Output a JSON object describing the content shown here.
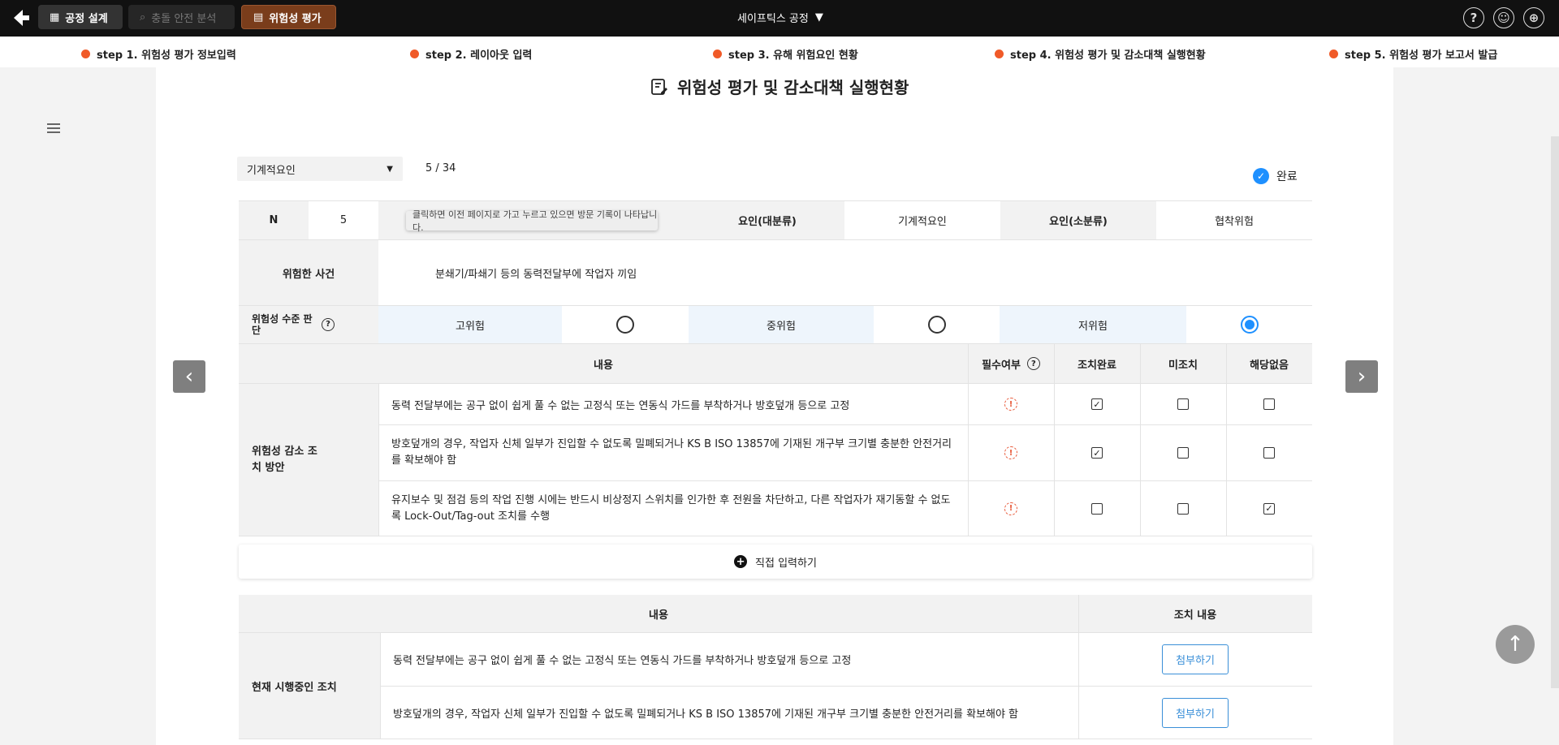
{
  "topbar": {
    "buttons": [
      "공정 설계",
      "충돌 안전 분석",
      "위험성 평가"
    ],
    "factory": "세이프틱스 공정"
  },
  "steps": [
    "step 1. 위험성 평가 정보입력",
    "step 2. 레이아웃 입력",
    "step 3. 유해 위험요인 현황",
    "step 4. 위험성 평가 및 감소대책 실행현황",
    "step 5. 위험성 평가 보고서 발급"
  ],
  "page_title": "위험성 평가 및 감소대책 실행현황",
  "filter": {
    "selected": "기계적요인",
    "pager": "5 / 34",
    "done_label": "완료"
  },
  "tooltip": "클릭하면 이전 페이지로 가고 누르고 있으면 방문 기록이 나타납니다.",
  "info": {
    "n_label": "N",
    "n_value": "5",
    "major_label": "요인(대분류)",
    "major_value": "기계적요인",
    "minor_label": "요인(소분류)",
    "minor_value": "협착위험",
    "event_label": "위험한 사건",
    "event_value": "분쇄기/파쇄기 등의 동력전달부에 작업자 끼임"
  },
  "risk": {
    "label": "위험성 수준 판단",
    "levels": [
      "고위험",
      "중위험",
      "저위험"
    ],
    "selected_index": 2
  },
  "measures": {
    "header_content": "내용",
    "header_required": "필수여부",
    "header_done": "조치완료",
    "header_not": "미조치",
    "header_na": "해당없음",
    "side_label": "위험성 감소 조치 방안",
    "rows": [
      {
        "text": "동력 전달부에는 공구 없이 쉽게 풀 수 없는 고정식 또는 연동식 가드를 부착하거나 방호덮개 등으로 고정",
        "status": "done"
      },
      {
        "text": "방호덮개의 경우, 작업자 신체 일부가 진입할 수 없도록 밀폐되거나 KS B ISO 13857에 기재된 개구부 크기별 충분한 안전거리를 확보해야 함",
        "status": "done"
      },
      {
        "text": "유지보수 및 점검 등의 작업 진행 시에는 반드시 비상정지 스위치를 인가한 후 전원을 차단하고, 다른 작업자가 재기동할 수 없도록 Lock-Out/Tag-out 조치를 수행",
        "status": "na"
      }
    ],
    "add_label": "직접 입력하기"
  },
  "current": {
    "header_content": "내용",
    "header_action": "조치 내용",
    "side_label": "현재 시행중인 조치",
    "rows": [
      {
        "text": "동력 전달부에는 공구 없이 쉽게 풀 수 없는 고정식 또는 연동식 가드를 부착하거나 방호덮개 등으로 고정",
        "button": "첨부하기"
      },
      {
        "text": "방호덮개의 경우, 작업자 신체 일부가 진입할 수 없도록 밀폐되거나 KS B ISO 13857에 기재된 개구부 크기별 충분한 안전거리를 확보해야 함",
        "button": "첨부하기"
      }
    ]
  },
  "colors": {
    "accent": "#1e90ff",
    "step_dot": "#f05a28",
    "active_tab": "#7a3d1b"
  }
}
